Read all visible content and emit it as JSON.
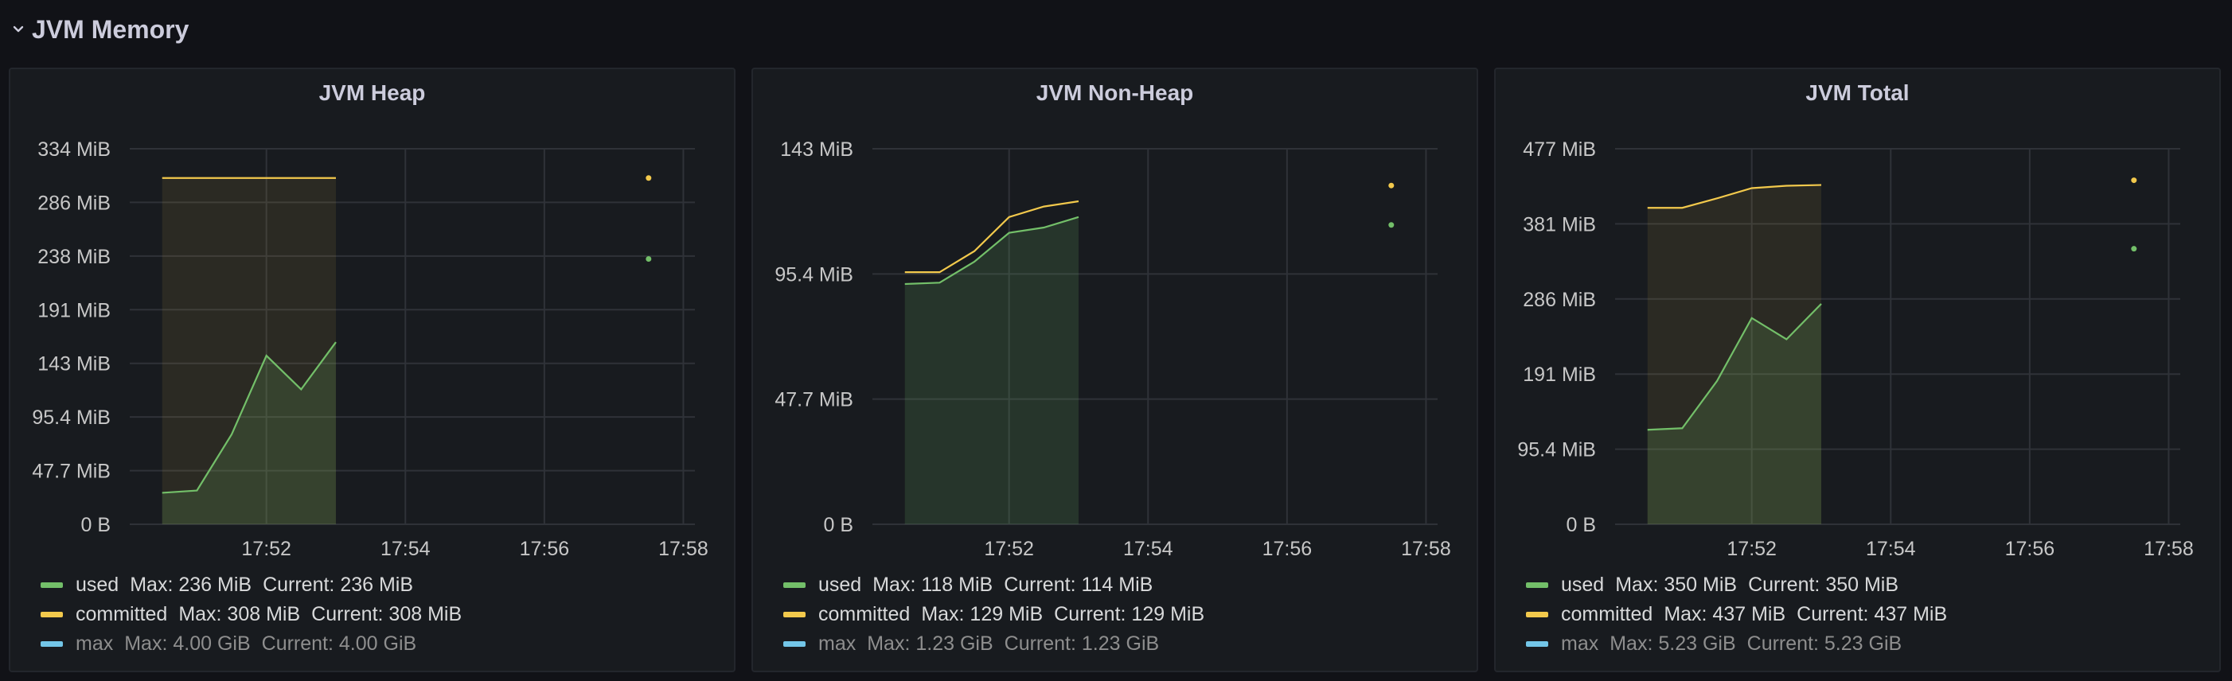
{
  "row": {
    "title": "JVM Memory"
  },
  "colors": {
    "used": "#73bf69",
    "committed": "#f2c94c",
    "max": "#8ab8ff",
    "max_swatch": "#73c6e8",
    "grid": "#2f3238",
    "axis_text": "#c7c7c7"
  },
  "chart_data": [
    {
      "type": "area",
      "title": "JVM Heap",
      "x_ticks": [
        "17:52",
        "17:54",
        "17:56",
        "17:58"
      ],
      "y_ticks": [
        "334 MiB",
        "286 MiB",
        "238 MiB",
        "191 MiB",
        "143 MiB",
        "95.4 MiB",
        "47.7 MiB",
        "0 B"
      ],
      "ylim": [
        0,
        334
      ],
      "series": [
        {
          "name": "used",
          "color": "#73bf69",
          "fill": true,
          "x": [
            "17:50:30",
            "17:51",
            "17:51:30",
            "17:52",
            "17:52:30",
            "17:53"
          ],
          "values": [
            28,
            30,
            80,
            150,
            120,
            162
          ],
          "isolated": {
            "x": "17:57:30",
            "value": 236
          }
        },
        {
          "name": "committed",
          "color": "#f2c94c",
          "fill": true,
          "x": [
            "17:50:30",
            "17:51",
            "17:51:30",
            "17:52",
            "17:52:30",
            "17:53"
          ],
          "values": [
            308,
            308,
            308,
            308,
            308,
            308
          ],
          "isolated": {
            "x": "17:57:30",
            "value": 308
          }
        }
      ],
      "legend": [
        {
          "name": "used",
          "max": "Max: 236 MiB",
          "current": "Current: 236 MiB",
          "color": "#73bf69",
          "dim": false
        },
        {
          "name": "committed",
          "max": "Max: 308 MiB",
          "current": "Current: 308 MiB",
          "color": "#f2c94c",
          "dim": false
        },
        {
          "name": "max",
          "max": "Max: 4.00 GiB",
          "current": "Current: 4.00 GiB",
          "color": "#73c6e8",
          "dim": true
        }
      ]
    },
    {
      "type": "area",
      "title": "JVM Non-Heap",
      "x_ticks": [
        "17:52",
        "17:54",
        "17:56",
        "17:58"
      ],
      "y_ticks": [
        "143 MiB",
        "95.4 MiB",
        "47.7 MiB",
        "0 B"
      ],
      "ylim": [
        0,
        143
      ],
      "series": [
        {
          "name": "used",
          "color": "#73bf69",
          "fill": true,
          "x": [
            "17:50:30",
            "17:51",
            "17:51:30",
            "17:52",
            "17:52:30",
            "17:53"
          ],
          "values": [
            91.5,
            92,
            100,
            111,
            113,
            117
          ],
          "isolated": {
            "x": "17:57:30",
            "value": 114
          }
        },
        {
          "name": "committed",
          "color": "#f2c94c",
          "fill": false,
          "x": [
            "17:50:30",
            "17:51",
            "17:51:30",
            "17:52",
            "17:52:30",
            "17:53"
          ],
          "values": [
            96,
            96,
            104,
            117,
            121,
            123
          ],
          "isolated": {
            "x": "17:57:30",
            "value": 129
          }
        }
      ],
      "legend": [
        {
          "name": "used",
          "max": "Max: 118 MiB",
          "current": "Current: 114 MiB",
          "color": "#73bf69",
          "dim": false
        },
        {
          "name": "committed",
          "max": "Max: 129 MiB",
          "current": "Current: 129 MiB",
          "color": "#f2c94c",
          "dim": false
        },
        {
          "name": "max",
          "max": "Max: 1.23 GiB",
          "current": "Current: 1.23 GiB",
          "color": "#73c6e8",
          "dim": true
        }
      ]
    },
    {
      "type": "area",
      "title": "JVM Total",
      "x_ticks": [
        "17:52",
        "17:54",
        "17:56",
        "17:58"
      ],
      "y_ticks": [
        "477 MiB",
        "381 MiB",
        "286 MiB",
        "191 MiB",
        "95.4 MiB",
        "0 B"
      ],
      "ylim": [
        0,
        477
      ],
      "series": [
        {
          "name": "used",
          "color": "#73bf69",
          "fill": true,
          "x": [
            "17:50:30",
            "17:51",
            "17:51:30",
            "17:52",
            "17:52:30",
            "17:53"
          ],
          "values": [
            120,
            122,
            182,
            262,
            235,
            280
          ],
          "isolated": {
            "x": "17:57:30",
            "value": 350
          }
        },
        {
          "name": "committed",
          "color": "#f2c94c",
          "fill": true,
          "x": [
            "17:50:30",
            "17:51",
            "17:51:30",
            "17:52",
            "17:52:30",
            "17:53"
          ],
          "values": [
            402,
            402,
            414,
            427,
            430,
            431
          ],
          "isolated": {
            "x": "17:57:30",
            "value": 437
          }
        }
      ],
      "legend": [
        {
          "name": "used",
          "max": "Max: 350 MiB",
          "current": "Current: 350 MiB",
          "color": "#73bf69",
          "dim": false
        },
        {
          "name": "committed",
          "max": "Max: 437 MiB",
          "current": "Current: 437 MiB",
          "color": "#f2c94c",
          "dim": false
        },
        {
          "name": "max",
          "max": "Max: 5.23 GiB",
          "current": "Current: 5.23 GiB",
          "color": "#73c6e8",
          "dim": true
        }
      ]
    }
  ]
}
